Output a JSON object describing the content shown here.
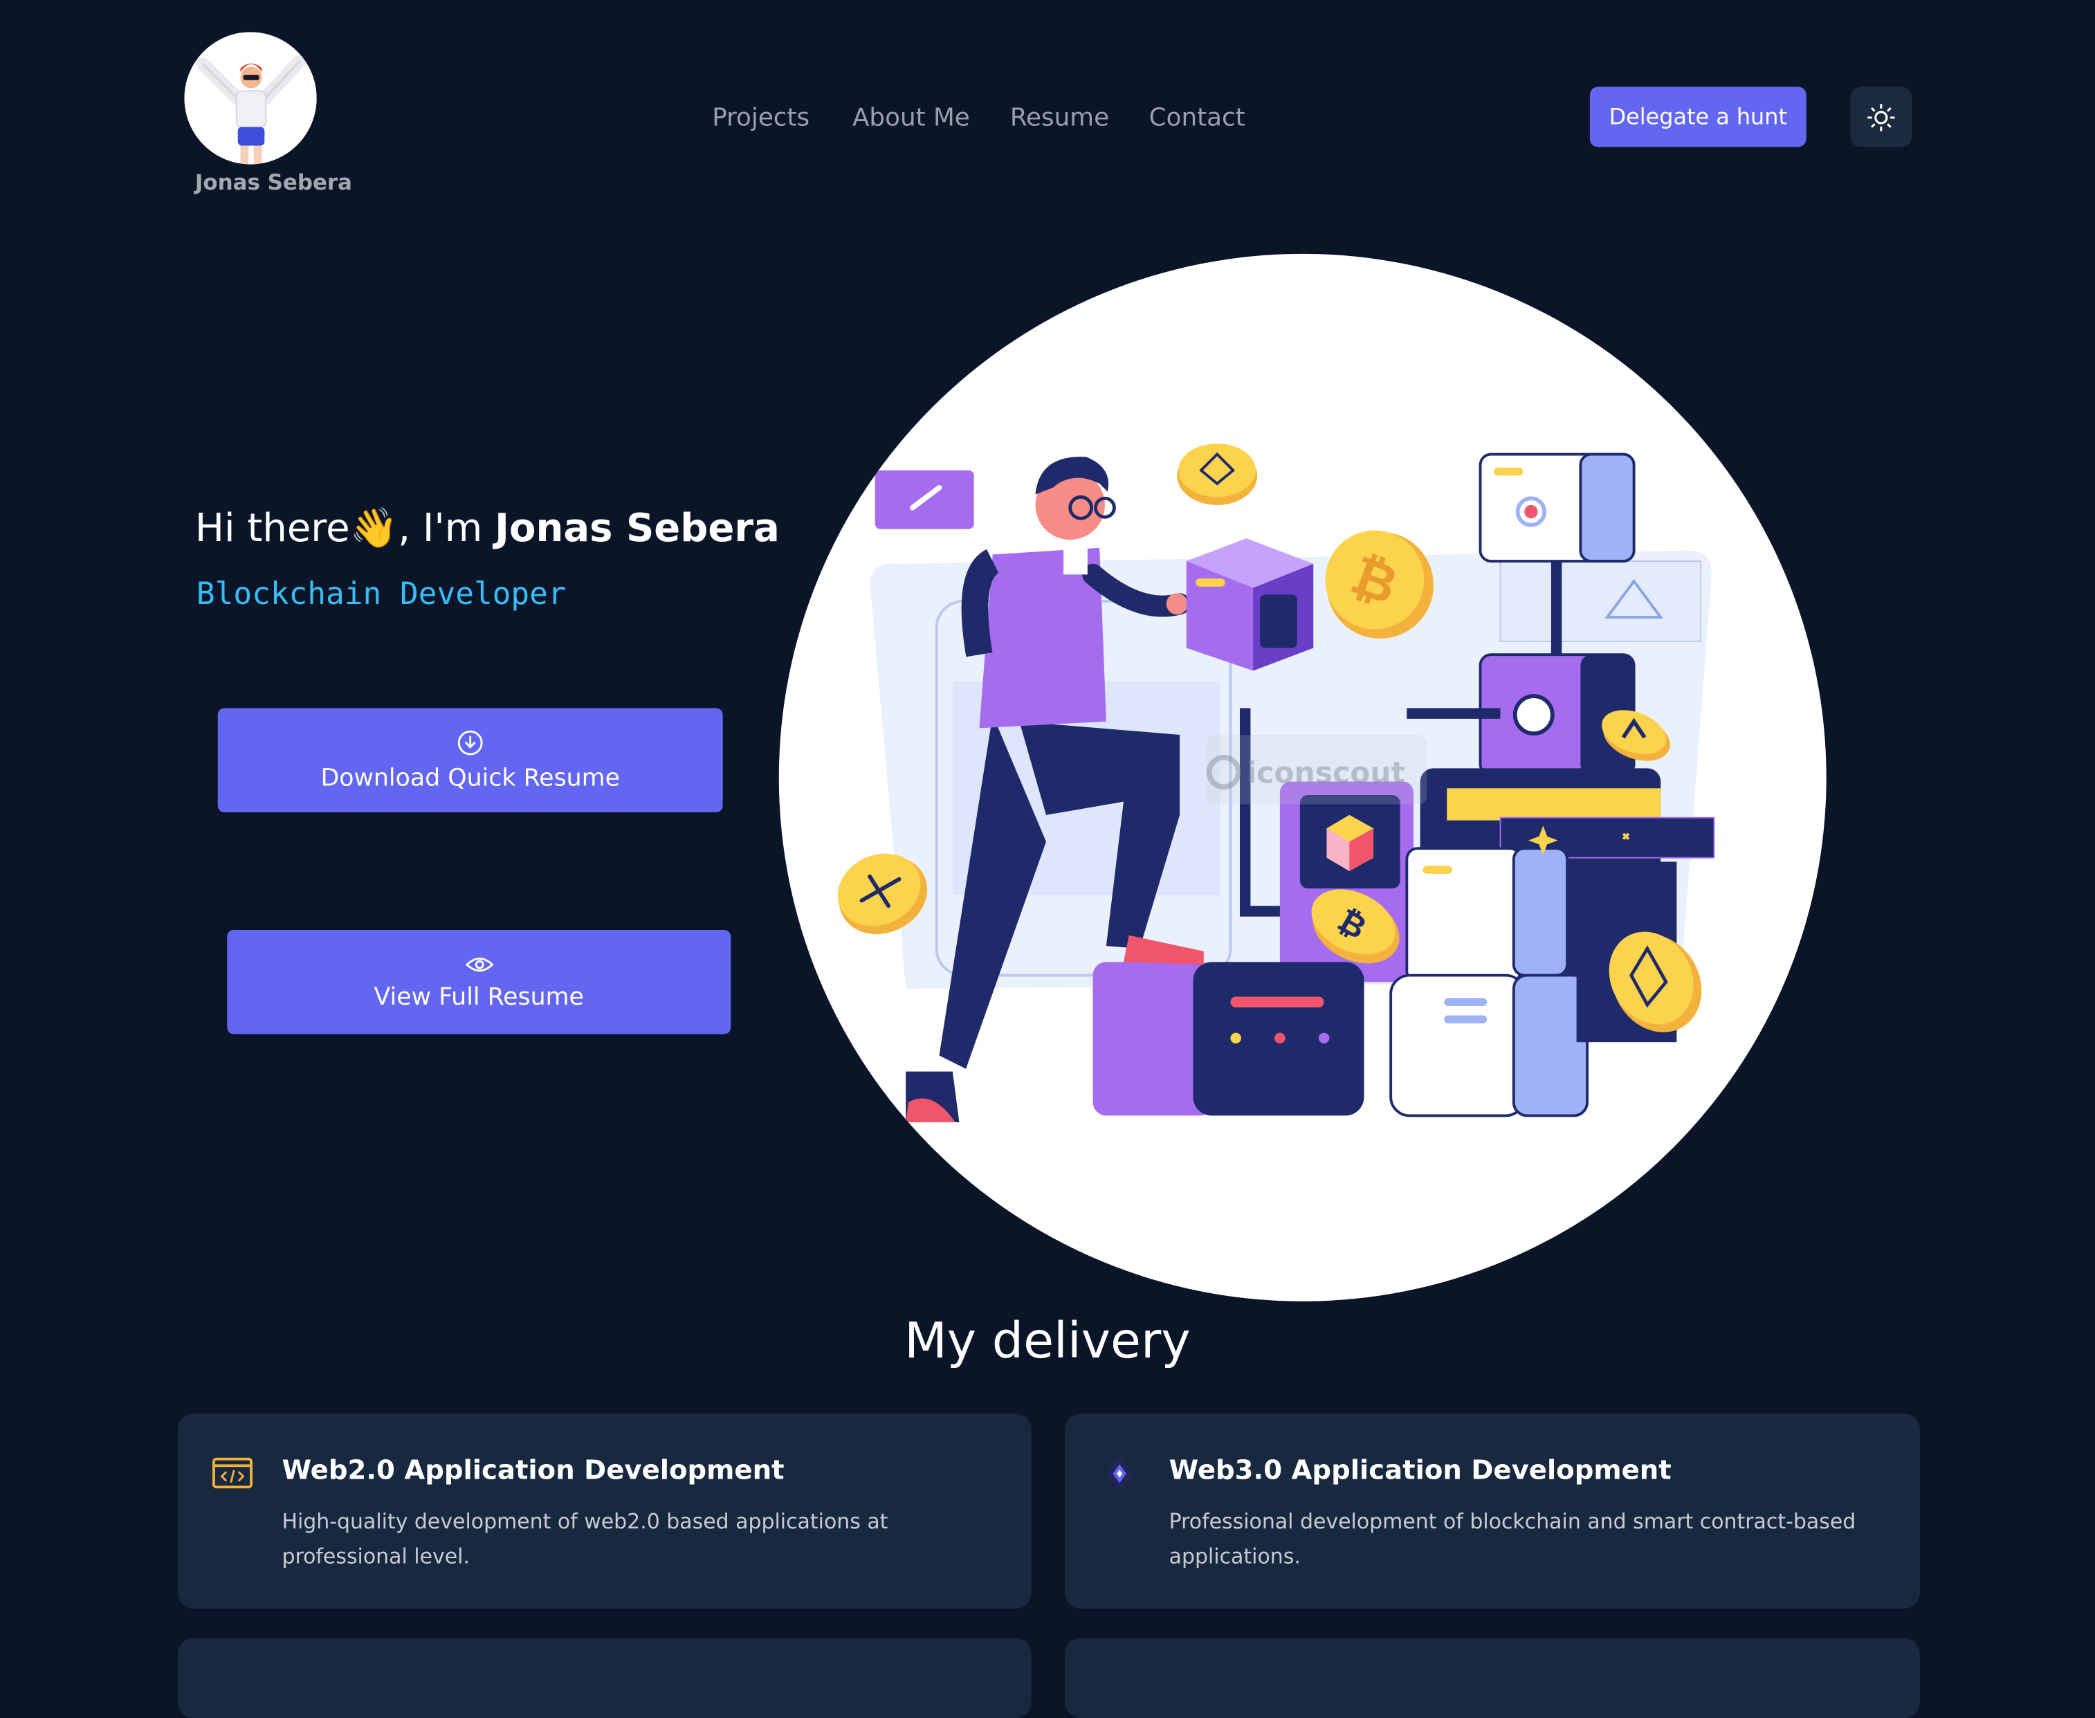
{
  "logo": {
    "name": "Jonas Sebera",
    "icon": "avatar-illustration"
  },
  "nav": {
    "links": [
      "Projects",
      "About Me",
      "Resume",
      "Contact"
    ],
    "cta_label": "Delegate a hunt",
    "theme_icon": "sun-icon"
  },
  "hero": {
    "greeting_prefix": "Hi there",
    "wave": "👋",
    "greeting_mid": ", I'm ",
    "name": "Jonas Sebera",
    "role": "Blockchain Developer",
    "download_label": "Download Quick Resume",
    "download_icon": "download-circle-icon",
    "view_label": "View Full Resume",
    "view_icon": "eye-icon",
    "illustration_watermark": "iconscout"
  },
  "delivery": {
    "title": "My delivery",
    "cards": [
      {
        "icon": "code-window-icon",
        "title": "Web2.0 Application Development",
        "description": "High-quality development of web2.0 based applications at professional level."
      },
      {
        "icon": "ethereum-diamond-icon",
        "title": "Web3.0 Application Development",
        "description": "Professional development of blockchain and smart contract-based applications."
      }
    ]
  },
  "colors": {
    "background": "#0a1627",
    "accent": "#6366f1",
    "role_text": "#38bdf8",
    "card": "#17283f"
  }
}
